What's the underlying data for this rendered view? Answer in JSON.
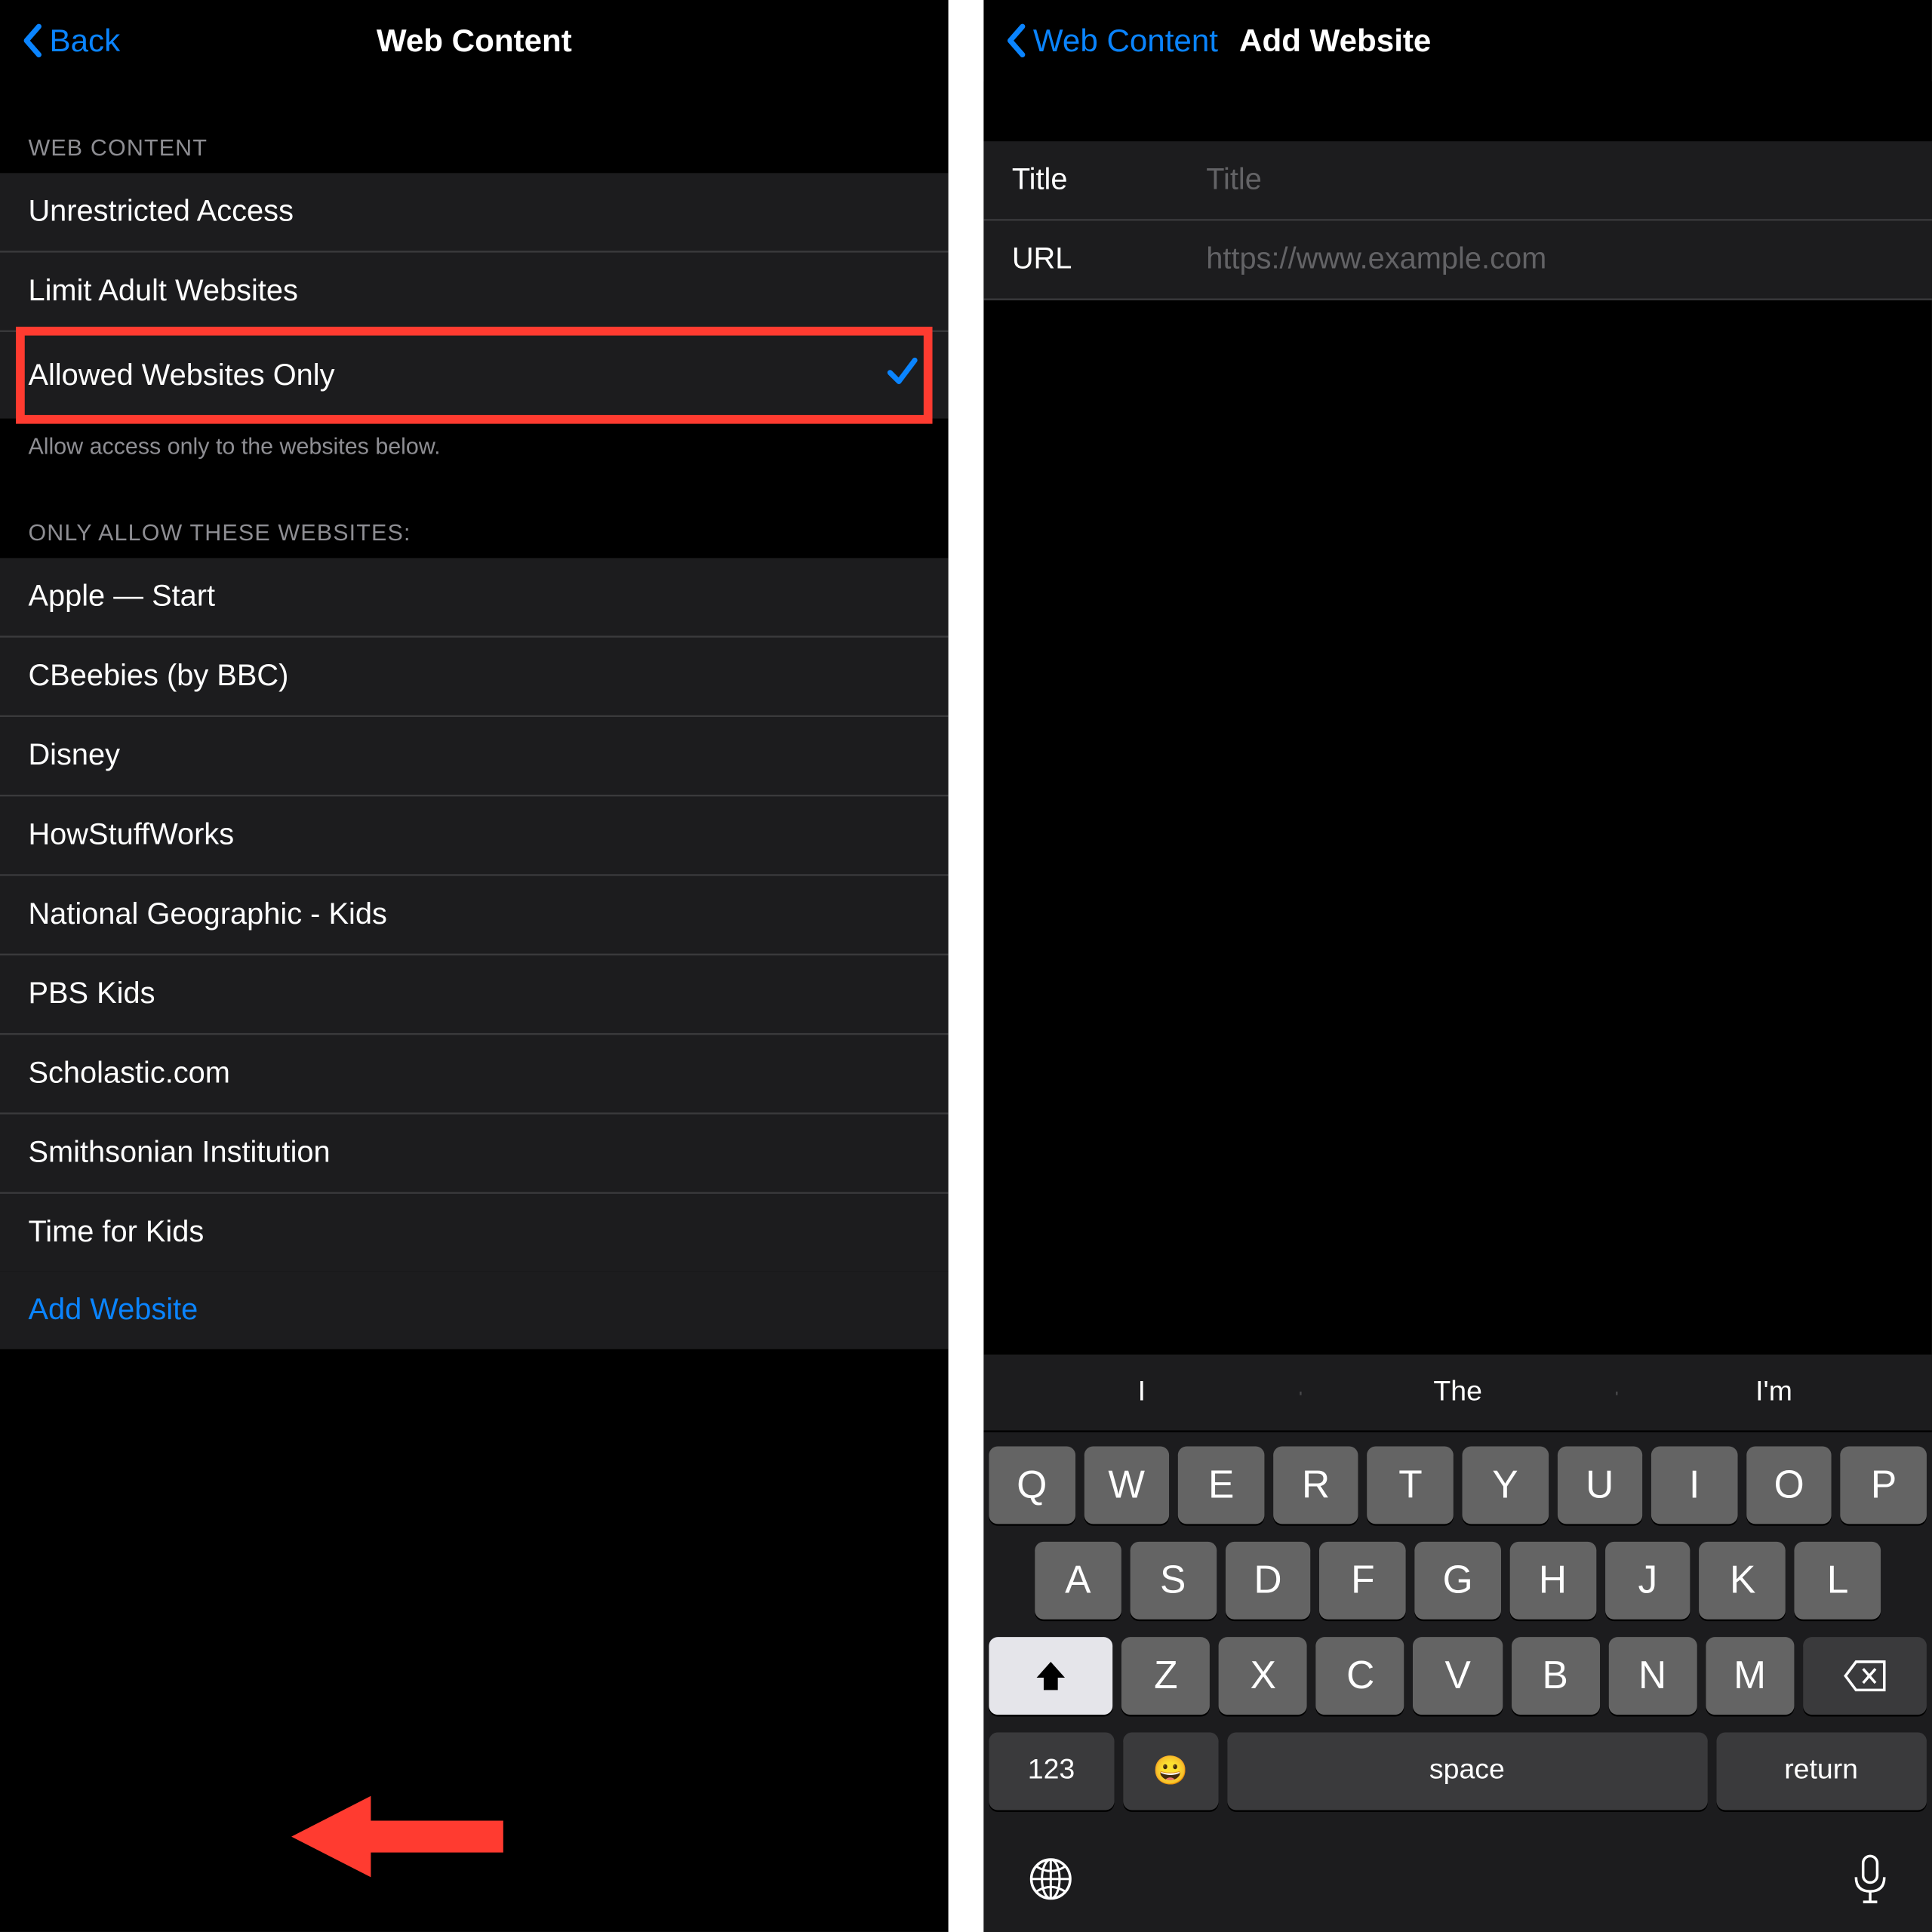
{
  "left": {
    "nav": {
      "back": "Back",
      "title": "Web Content"
    },
    "section1Header": "WEB CONTENT",
    "options": [
      {
        "label": "Unrestricted Access",
        "selected": false
      },
      {
        "label": "Limit Adult Websites",
        "selected": false
      },
      {
        "label": "Allowed Websites Only",
        "selected": true
      }
    ],
    "footer": "Allow access only to the websites below.",
    "section2Header": "ONLY ALLOW THESE WEBSITES:",
    "websites": [
      "Apple — Start",
      "CBeebies (by BBC)",
      "Disney",
      "HowStuffWorks",
      "National Geographic - Kids",
      "PBS Kids",
      "Scholastic.com",
      "Smithsonian Institution",
      "Time for Kids"
    ],
    "addWebsite": "Add Website"
  },
  "right": {
    "nav": {
      "back": "Web Content",
      "title": "Add Website"
    },
    "form": {
      "titleLabel": "Title",
      "titlePlaceholder": "Title",
      "urlLabel": "URL",
      "urlPlaceholder": "https://www.example.com"
    },
    "keyboard": {
      "predictions": [
        "I",
        "The",
        "I'm"
      ],
      "row1": [
        "Q",
        "W",
        "E",
        "R",
        "T",
        "Y",
        "U",
        "I",
        "O",
        "P"
      ],
      "row2": [
        "A",
        "S",
        "D",
        "F",
        "G",
        "H",
        "J",
        "K",
        "L"
      ],
      "row3": [
        "Z",
        "X",
        "C",
        "V",
        "B",
        "N",
        "M"
      ],
      "numKey": "123",
      "space": "space",
      "return": "return"
    }
  }
}
